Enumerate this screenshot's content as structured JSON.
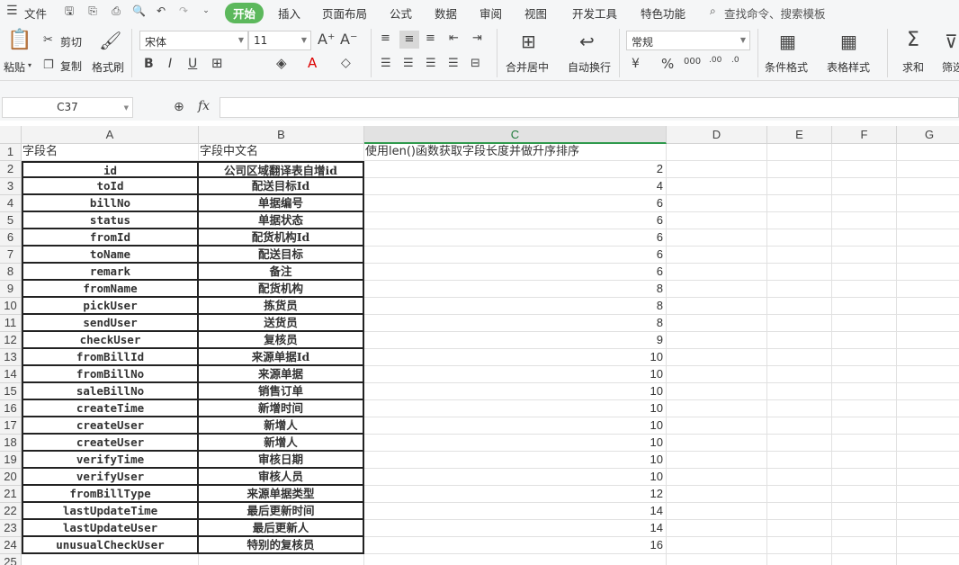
{
  "menu": {
    "file": "文件",
    "tabs": [
      "开始",
      "插入",
      "页面布局",
      "公式",
      "数据",
      "审阅",
      "视图",
      "开发工具",
      "特色功能"
    ],
    "search_placeholder": "查找命令、搜索模板"
  },
  "ribbon": {
    "paste": "粘贴",
    "cut": "剪切",
    "copy": "复制",
    "format_painter": "格式刷",
    "font_name": "宋体",
    "font_size": "11",
    "merge_center": "合并居中",
    "wrap_text": "自动换行",
    "number_format": "常规",
    "conditional_format": "条件格式",
    "table_style": "表格样式",
    "sum": "求和",
    "filter": "筛选"
  },
  "formula_bar": {
    "cell_ref": "C37",
    "fx": "fx",
    "value": ""
  },
  "sheet": {
    "columns": [
      "A",
      "B",
      "C",
      "D",
      "E",
      "F",
      "G"
    ],
    "selected_column": "C",
    "header_row": [
      "字段名",
      "字段中文名",
      "使用len()函数获取字段长度并做升序排序"
    ],
    "rows": [
      [
        "id",
        "公司区域翻译表自增id",
        "2"
      ],
      [
        "toId",
        "配送目标Id",
        "4"
      ],
      [
        "billNo",
        "单据编号",
        "6"
      ],
      [
        "status",
        "单据状态",
        "6"
      ],
      [
        "fromId",
        "配货机构Id",
        "6"
      ],
      [
        "toName",
        "配送目标",
        "6"
      ],
      [
        "remark",
        "备注",
        "6"
      ],
      [
        "fromName",
        "配货机构",
        "8"
      ],
      [
        "pickUser",
        "拣货员",
        "8"
      ],
      [
        "sendUser",
        "送货员",
        "8"
      ],
      [
        "checkUser",
        "复核员",
        "9"
      ],
      [
        "fromBillId",
        "来源单据Id",
        "10"
      ],
      [
        "fromBillNo",
        "来源单据",
        "10"
      ],
      [
        "saleBillNo",
        "销售订单",
        "10"
      ],
      [
        "createTime",
        "新增时间",
        "10"
      ],
      [
        "createUser",
        "新增人",
        "10"
      ],
      [
        "createUser",
        "新增人",
        "10"
      ],
      [
        "verifyTime",
        "审核日期",
        "10"
      ],
      [
        "verifyUser",
        "审核人员",
        "10"
      ],
      [
        "fromBillType",
        "来源单据类型",
        "12"
      ],
      [
        "lastUpdateTime",
        "最后更新时间",
        "14"
      ],
      [
        "lastUpdateUser",
        "最后更新人",
        "14"
      ],
      [
        "unusualCheckUser",
        "特别的复核员",
        "16"
      ]
    ],
    "last_row_number": "25"
  }
}
